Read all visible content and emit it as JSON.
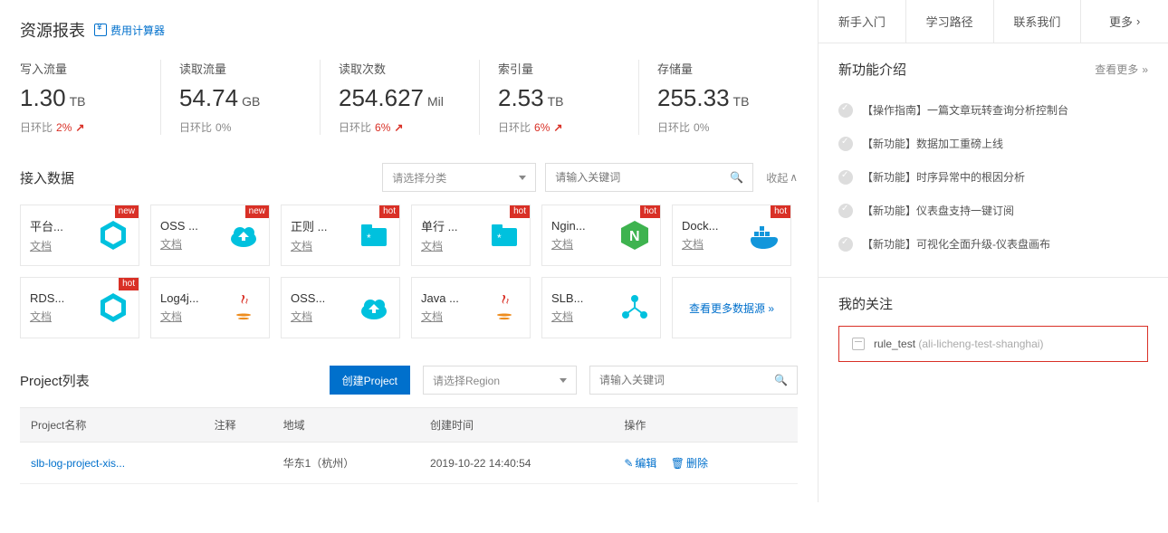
{
  "header": {
    "title": "资源报表",
    "calc": "费用计算器"
  },
  "metrics": [
    {
      "label": "写入流量",
      "value": "1.30",
      "unit": "TB",
      "delta_label": "日环比",
      "pct": "2%",
      "trend": "up"
    },
    {
      "label": "读取流量",
      "value": "54.74",
      "unit": "GB",
      "delta_label": "日环比",
      "pct": "0%",
      "trend": "flat"
    },
    {
      "label": "读取次数",
      "value": "254.627",
      "unit": "Mil",
      "delta_label": "日环比",
      "pct": "6%",
      "trend": "up"
    },
    {
      "label": "索引量",
      "value": "2.53",
      "unit": "TB",
      "delta_label": "日环比",
      "pct": "6%",
      "trend": "up"
    },
    {
      "label": "存储量",
      "value": "255.33",
      "unit": "TB",
      "delta_label": "日环比",
      "pct": "0%",
      "trend": "flat"
    }
  ],
  "access": {
    "title": "接入数据",
    "category_placeholder": "请选择分类",
    "keyword_placeholder": "请输入关键词",
    "collapse": "收起",
    "more_sources": "查看更多数据源 »",
    "doc_label": "文档",
    "cards": [
      {
        "title": "平台...",
        "badge": "new",
        "icon": "hex"
      },
      {
        "title": "OSS ...",
        "badge": "new",
        "icon": "cloud"
      },
      {
        "title": "正则 ...",
        "badge": "hot",
        "icon": "folder"
      },
      {
        "title": "单行 ...",
        "badge": "hot",
        "icon": "folder"
      },
      {
        "title": "Ngin...",
        "badge": "hot",
        "icon": "nginx"
      },
      {
        "title": "Dock...",
        "badge": "hot",
        "icon": "docker"
      },
      {
        "title": "RDS...",
        "badge": "hot",
        "icon": "hex"
      },
      {
        "title": "Log4j...",
        "badge": "",
        "icon": "java"
      },
      {
        "title": "OSS...",
        "badge": "",
        "icon": "cloud"
      },
      {
        "title": "Java ...",
        "badge": "",
        "icon": "java"
      },
      {
        "title": "SLB...",
        "badge": "",
        "icon": "slb"
      }
    ]
  },
  "projects": {
    "title": "Project列表",
    "create_btn": "创建Project",
    "region_placeholder": "请选择Region",
    "keyword_placeholder": "请输入关键词",
    "columns": {
      "name": "Project名称",
      "note": "注释",
      "region": "地域",
      "created": "创建时间",
      "ops": "操作"
    },
    "rows": [
      {
        "name": "slb-log-project-xis...",
        "note": "",
        "region": "华东1（杭州）",
        "created": "2019-10-22 14:40:54",
        "edit_label": "编辑",
        "delete_label": "删除"
      }
    ]
  },
  "side": {
    "tabs": [
      "新手入门",
      "学习路径",
      "联系我们",
      "更多"
    ],
    "features": {
      "title": "新功能介绍",
      "view_more": "查看更多",
      "items": [
        "【操作指南】一篇文章玩转查询分析控制台",
        "【新功能】数据加工重磅上线",
        "【新功能】时序异常中的根因分析",
        "【新功能】仪表盘支持一键订阅",
        "【新功能】可视化全面升级-仪表盘画布"
      ]
    },
    "follow": {
      "title": "我的关注",
      "name": "rule_test",
      "path": "(ali-licheng-test-shanghai)"
    }
  }
}
